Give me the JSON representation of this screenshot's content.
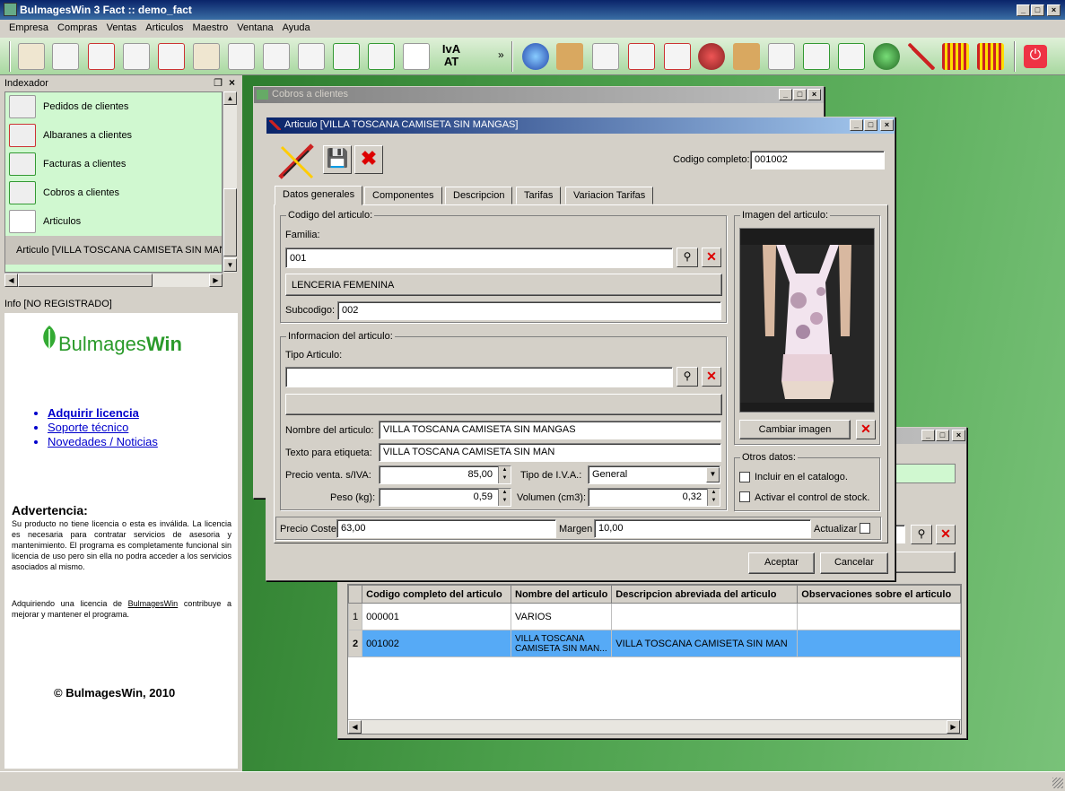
{
  "app": {
    "title": "BulmagesWin 3 Fact :: demo_fact"
  },
  "menu": [
    "Empresa",
    "Compras",
    "Ventas",
    "Articulos",
    "Maestro",
    "Ventana",
    "Ayuda"
  ],
  "toolbar": {
    "overflow": "»"
  },
  "indexador": {
    "title": "Indexador",
    "items": [
      {
        "label": "Pedidos de clientes",
        "icon": "pedidos-icon"
      },
      {
        "label": "Albaranes a clientes",
        "icon": "albaranes-icon"
      },
      {
        "label": "Facturas a clientes",
        "icon": "facturas-icon"
      },
      {
        "label": "Cobros a clientes",
        "icon": "cobros-icon"
      },
      {
        "label": "Articulos",
        "icon": "articulos-icon"
      },
      {
        "label": "Articulo [VILLA TOSCANA CAMISETA SIN MANGAS]",
        "icon": "articulo-edit-icon"
      }
    ]
  },
  "info": {
    "title": "Info [NO REGISTRADO]",
    "logo_text_a": "Bulmages",
    "logo_text_b": "Win",
    "links": [
      "Adquirir licencia",
      "Soporte técnico",
      "Novedades / Noticias"
    ],
    "warning_title": "Advertencia:",
    "warning_text": "Su producto no tiene licencia o esta es inválida. La licencia es necesaria para contratar servicios de asesoria y mantenimiento. El programa es completamente funcional sin licencia de uso pero sin ella no podra acceder a los servicios asociados al mismo.",
    "warning_text2_a": "Adquiriendo una licencia de ",
    "warning_text2_brand": "BulmagesWin",
    "warning_text2_b": " contribuye a mejorar y mantener el programa.",
    "copyright": "© BulmagesWin, 2010"
  },
  "cobros_window": {
    "title": "Cobros a clientes"
  },
  "articulo": {
    "title": "Articulo [VILLA TOSCANA CAMISETA SIN MANGAS]",
    "codigo_completo_label": "Codigo completo:",
    "codigo_completo": "001002",
    "tabs": [
      "Datos generales",
      "Componentes",
      "Descripcion",
      "Tarifas",
      "Variacion Tarifas"
    ],
    "group_codigo": "Codigo del articulo:",
    "familia_label": "Familia:",
    "familia_value": "001",
    "familia_name": "LENCERIA FEMENINA",
    "subcodigo_label": "Subcodigo:",
    "subcodigo_value": "002",
    "group_info": "Informacion del articulo:",
    "tipo_label": "Tipo Articulo:",
    "tipo_value": "",
    "nombre_label": "Nombre del articulo:",
    "nombre_value": "VILLA TOSCANA CAMISETA SIN MANGAS",
    "etiqueta_label": "Texto para etiqueta:",
    "etiqueta_value": "VILLA TOSCANA CAMISETA SIN MAN",
    "precio_label": "Precio venta. s/IVA:",
    "precio_value": "85,00",
    "iva_label": "Tipo de I.V.A.:",
    "iva_value": "General",
    "peso_label": "Peso (kg):",
    "peso_value": "0,59",
    "volumen_label": "Volumen (cm3):",
    "volumen_value": "0,32",
    "imagen_label": "Imagen del articulo:",
    "cambiar_imagen": "Cambiar imagen",
    "otros_label": "Otros datos:",
    "catalogo_label": "Incluir en el catalogo.",
    "stock_label": "Activar el control de stock.",
    "coste_label": "Precio Coste",
    "coste_value": "63,00",
    "margen_label": "Margen",
    "margen_value": "10,00",
    "actualizar_label": "Actualizar",
    "aceptar": "Aceptar",
    "cancelar": "Cancelar"
  },
  "articulos_list": {
    "columns": [
      "Codigo completo del articulo",
      "Nombre del articulo",
      "Descripcion abreviada del articulo",
      "Observaciones sobre el articulo"
    ],
    "rows": [
      {
        "n": "1",
        "codigo": "000001",
        "nombre": "VARIOS",
        "desc": "",
        "obs": ""
      },
      {
        "n": "2",
        "codigo": "001002",
        "nombre": "VILLA TOSCANA CAMISETA SIN MAN...",
        "desc": "VILLA TOSCANA CAMISETA SIN MAN",
        "obs": ""
      }
    ]
  },
  "colors": {
    "accent": "#0a246a",
    "green_panel": "#d0f8d0",
    "selected_row": "#56aaf6"
  }
}
